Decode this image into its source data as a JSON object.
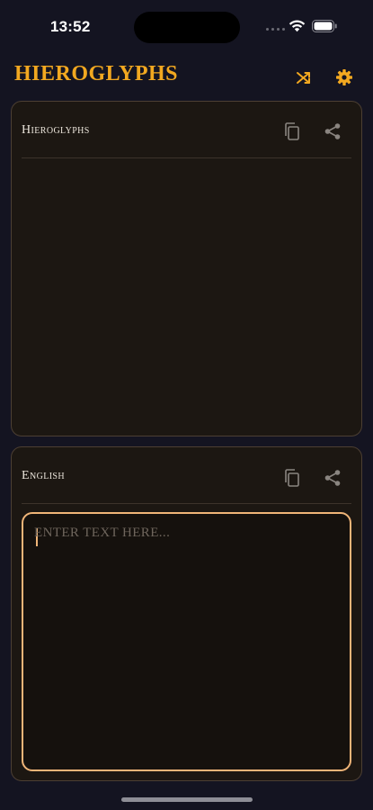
{
  "status_bar": {
    "time": "13:52",
    "icons": [
      "signal-dots-icon",
      "wifi-icon",
      "battery-icon"
    ]
  },
  "header": {
    "title": "Hieroglyphs",
    "actions": [
      {
        "name": "shuffle-icon",
        "color": "#f2a820"
      },
      {
        "name": "gear-icon",
        "color": "#f2a820"
      }
    ]
  },
  "hieroglyphs_panel": {
    "label": "Hieroglyphs",
    "output_text": "",
    "actions": [
      "copy-icon",
      "share-icon"
    ]
  },
  "english_panel": {
    "label": "English",
    "input": {
      "value": "",
      "placeholder": "Enter text here..."
    },
    "actions": [
      "copy-icon",
      "share-icon"
    ]
  },
  "colors": {
    "background": "#141421",
    "accent": "#f2a820",
    "panel": "#1c1712",
    "panel_border": "#4c3f33",
    "input_border": "#f0b578",
    "icon_muted": "#8a8580"
  }
}
